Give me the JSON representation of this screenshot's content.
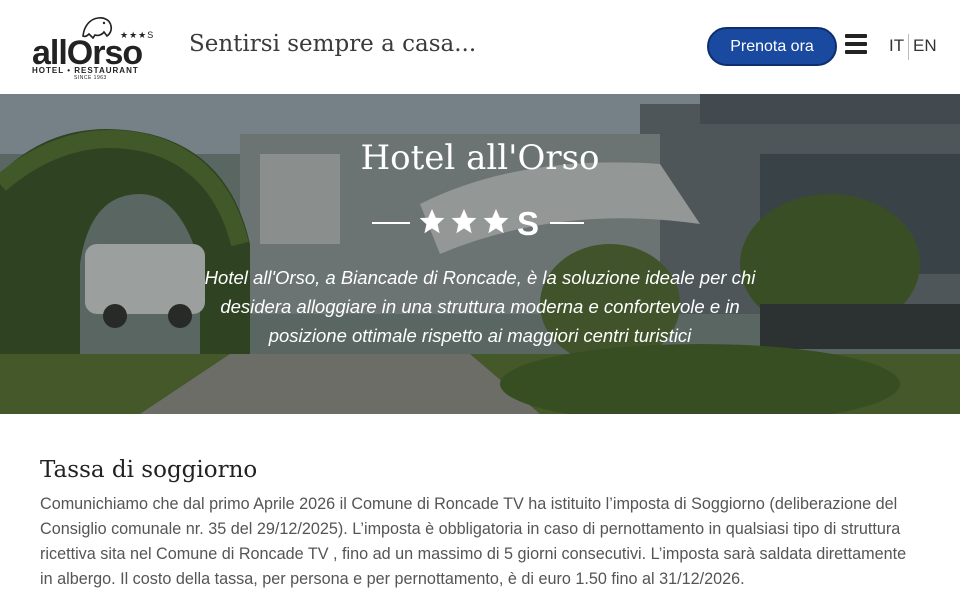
{
  "header": {
    "logo": {
      "word": "allOrso",
      "stars": "★★★S",
      "subtitle": "HOTEL • RESTAURANT",
      "since": "SINCE 1963"
    },
    "tagline": "Sentirsi sempre a casa...",
    "book_button": "Prenota ora",
    "menu_icon": "hamburger-menu-icon",
    "languages": [
      "IT",
      "EN"
    ]
  },
  "hero": {
    "title": "Hotel all'Orso",
    "rating_stars": 3,
    "rating_suffix": "S",
    "description": "Hotel all'Orso, a Biancade di Roncade, è la soluzione ideale per chi desidera alloggiare in una struttura moderna e confortevole e in posizione ottimale rispetto ai maggiori centri turistici"
  },
  "section": {
    "title": "Tassa di soggiorno",
    "body": "Comunichiamo che dal primo Aprile 2026 il Comune di Roncade TV ha istituito l’imposta di Soggiorno (deliberazione del Consiglio comunale nr. 35 del 29/12/2025). L’imposta è obbligatoria in caso di pernottamento in qualsiasi tipo di struttura ricettiva sita nel Comune di Roncade TV , fino ad un massimo di 5 giorni consecutivi. L’imposta sarà saldata direttamente in albergo. Il costo della tassa, per persona e per pernottamento, è di euro 1.50 fino al 31/12/2026."
  },
  "colors": {
    "accent": "#1a4aa0",
    "accent_border": "#0d2f6e",
    "text": "#555555",
    "heading": "#222222"
  }
}
